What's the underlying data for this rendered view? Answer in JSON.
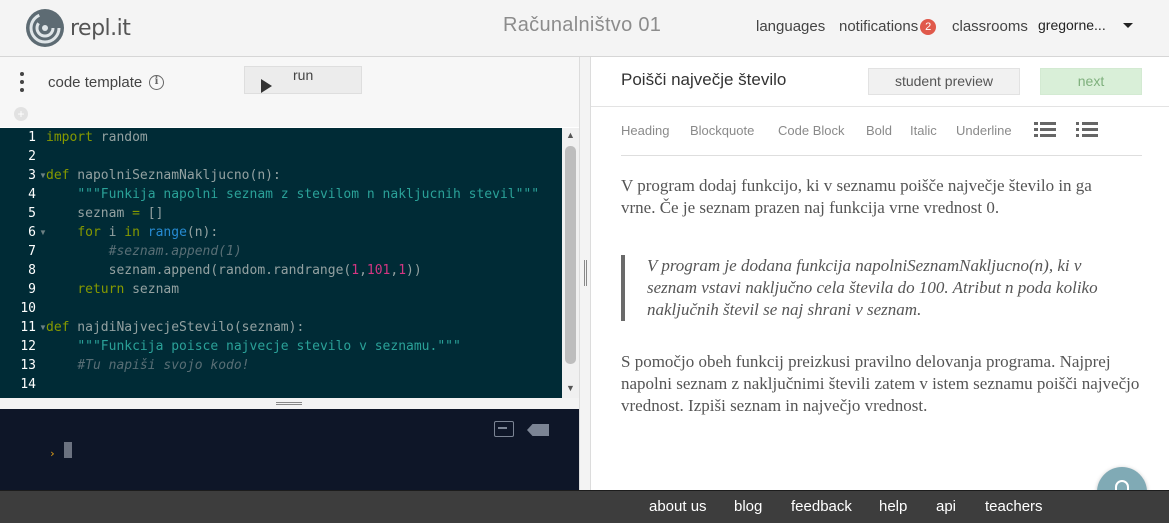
{
  "header": {
    "logo_text": "repl.it",
    "app_title": "Računalništvo 01",
    "nav": {
      "languages": "languages",
      "notifications": "notifications",
      "notifications_count": "2",
      "classrooms": "classrooms"
    },
    "user": "gregorne...",
    "accent_badge_color": "#e0594b"
  },
  "left": {
    "template_label": "code template",
    "info_glyph": "i",
    "run_label": "run",
    "code_lines": [
      "import random",
      "",
      "def napolniSeznamNakljucno(n):",
      "    \"\"\"Funkija napolni seznam z stevilom n nakljucnih stevil\"\"\"",
      "    seznam = []",
      "    for i in range(n):",
      "        #seznam.append(1)",
      "        seznam.append(random.randrange(1,101,1))",
      "    return seznam",
      "",
      "def najdiNajvecjeStevilo(seznam):",
      "    \"\"\"Funkcija poisce najvecje stevilo v seznamu.\"\"\"",
      "    #Tu napiši svojo kodo!",
      ""
    ],
    "line_numbers": [
      "1",
      "2",
      "3",
      "4",
      "5",
      "6",
      "7",
      "8",
      "9",
      "10",
      "11",
      "12",
      "13",
      "14"
    ],
    "console_prompt": "›",
    "editor_bg": "#002b36",
    "console_bg": "#0e1628"
  },
  "right": {
    "lesson_title": "Poišči največje število",
    "student_preview": "student preview",
    "next": "next",
    "toolbar": [
      "Heading",
      "Blockquote",
      "Code Block",
      "Bold",
      "Italic",
      "Underline"
    ],
    "para1": "V program dodaj funkcijo, ki v seznamu poišče največje število in ga vrne. Če je seznam prazen naj funkcija vrne vrednost 0.",
    "quote": "V program je dodana funkcija napolniSeznamNakljucno(n), ki v seznam vstavi naključno cela števila do 100. Atribut n poda koliko naključnih števil se naj shrani v seznam.",
    "para2": "S pomočjo obeh funkcij preizkusi pravilno delovanja programa. Najprej napolni seznam z naključnimi števili zatem v istem seznamu poišči največjo vrednost. Izpiši seznam in največjo vrednost.",
    "next_btn_color": "#d9efd8"
  },
  "footer": {
    "about": "about us",
    "blog": "blog",
    "feedback": "feedback",
    "help": "help",
    "api": "api",
    "teachers": "teachers"
  }
}
